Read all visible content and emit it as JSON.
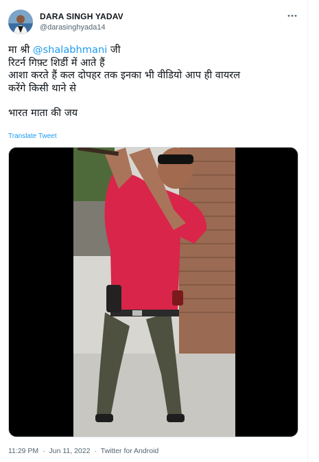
{
  "user": {
    "display_name": "DARA SINGH YADAV",
    "handle": "@darasinghyada14",
    "avatar_icon": "user-avatar-icon",
    "more_icon": "more-options-icon"
  },
  "tweet": {
    "line1_prefix": "मा श्री ",
    "mention": "@shalabhmani",
    "line1_suffix": " जी",
    "line2": "रिटर्न गिफ़्ट शिर्डी में आते हैं",
    "line3": "आशा करते हैं कल दोपहर तक इनका भी वीडियो आप ही वायरल",
    "line4": "करेंगे किसी थाने से",
    "line5": "भारत माता की जय"
  },
  "translate_label": "Translate Tweet",
  "meta": {
    "time": "11:29 PM",
    "sep1": "·",
    "date": "Jun 11, 2022",
    "sep2": "·",
    "source": "Twitter for Android"
  },
  "colors": {
    "accent": "#1d9bf0",
    "text": "#0f1419",
    "muted": "#536471"
  }
}
